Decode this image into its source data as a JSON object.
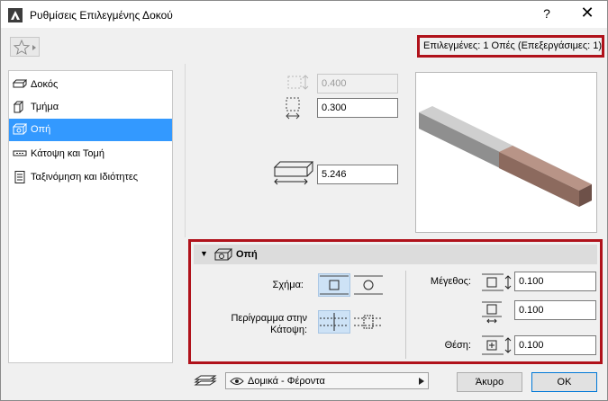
{
  "window": {
    "title": "Ρυθμίσεις Επιλεγμένης Δοκού",
    "help_label": "?",
    "close_label": "✕"
  },
  "selection_info": "Επιλεγμένες: 1 Οπές (Επεξεργάσιμες: 1)",
  "sidebar": {
    "items": [
      {
        "label": "Δοκός",
        "icon": "beam-icon"
      },
      {
        "label": "Τμήμα",
        "icon": "segment-icon"
      },
      {
        "label": "Οπή",
        "icon": "hole-icon",
        "active": true
      },
      {
        "label": "Κάτοψη και Τομή",
        "icon": "floor-plan-icon"
      },
      {
        "label": "Ταξινόμηση και Ιδιότητες",
        "icon": "document-icon"
      }
    ]
  },
  "params": {
    "height_value": "0.400",
    "width_value": "0.300",
    "length_value": "5.246"
  },
  "hole_panel": {
    "title": "Οπή",
    "shape_label": "Σχήμα:",
    "outline_label_line1": "Περίγραμμα στην",
    "outline_label_line2": "Κάτοψη:",
    "size_label": "Μέγεθος:",
    "size_width": "0.100",
    "size_height": "0.100",
    "position_label": "Θέση:",
    "position_value": "0.100"
  },
  "bottom": {
    "layer_label": "Δομικά - Φέροντα",
    "cancel_label": "Άκυρο",
    "ok_label": "ΟΚ"
  },
  "colors": {
    "accent": "#3399ff",
    "highlight_border": "#b0121b",
    "beam_gray": "#a9a9a9",
    "beam_brown": "#8f6a5e"
  }
}
